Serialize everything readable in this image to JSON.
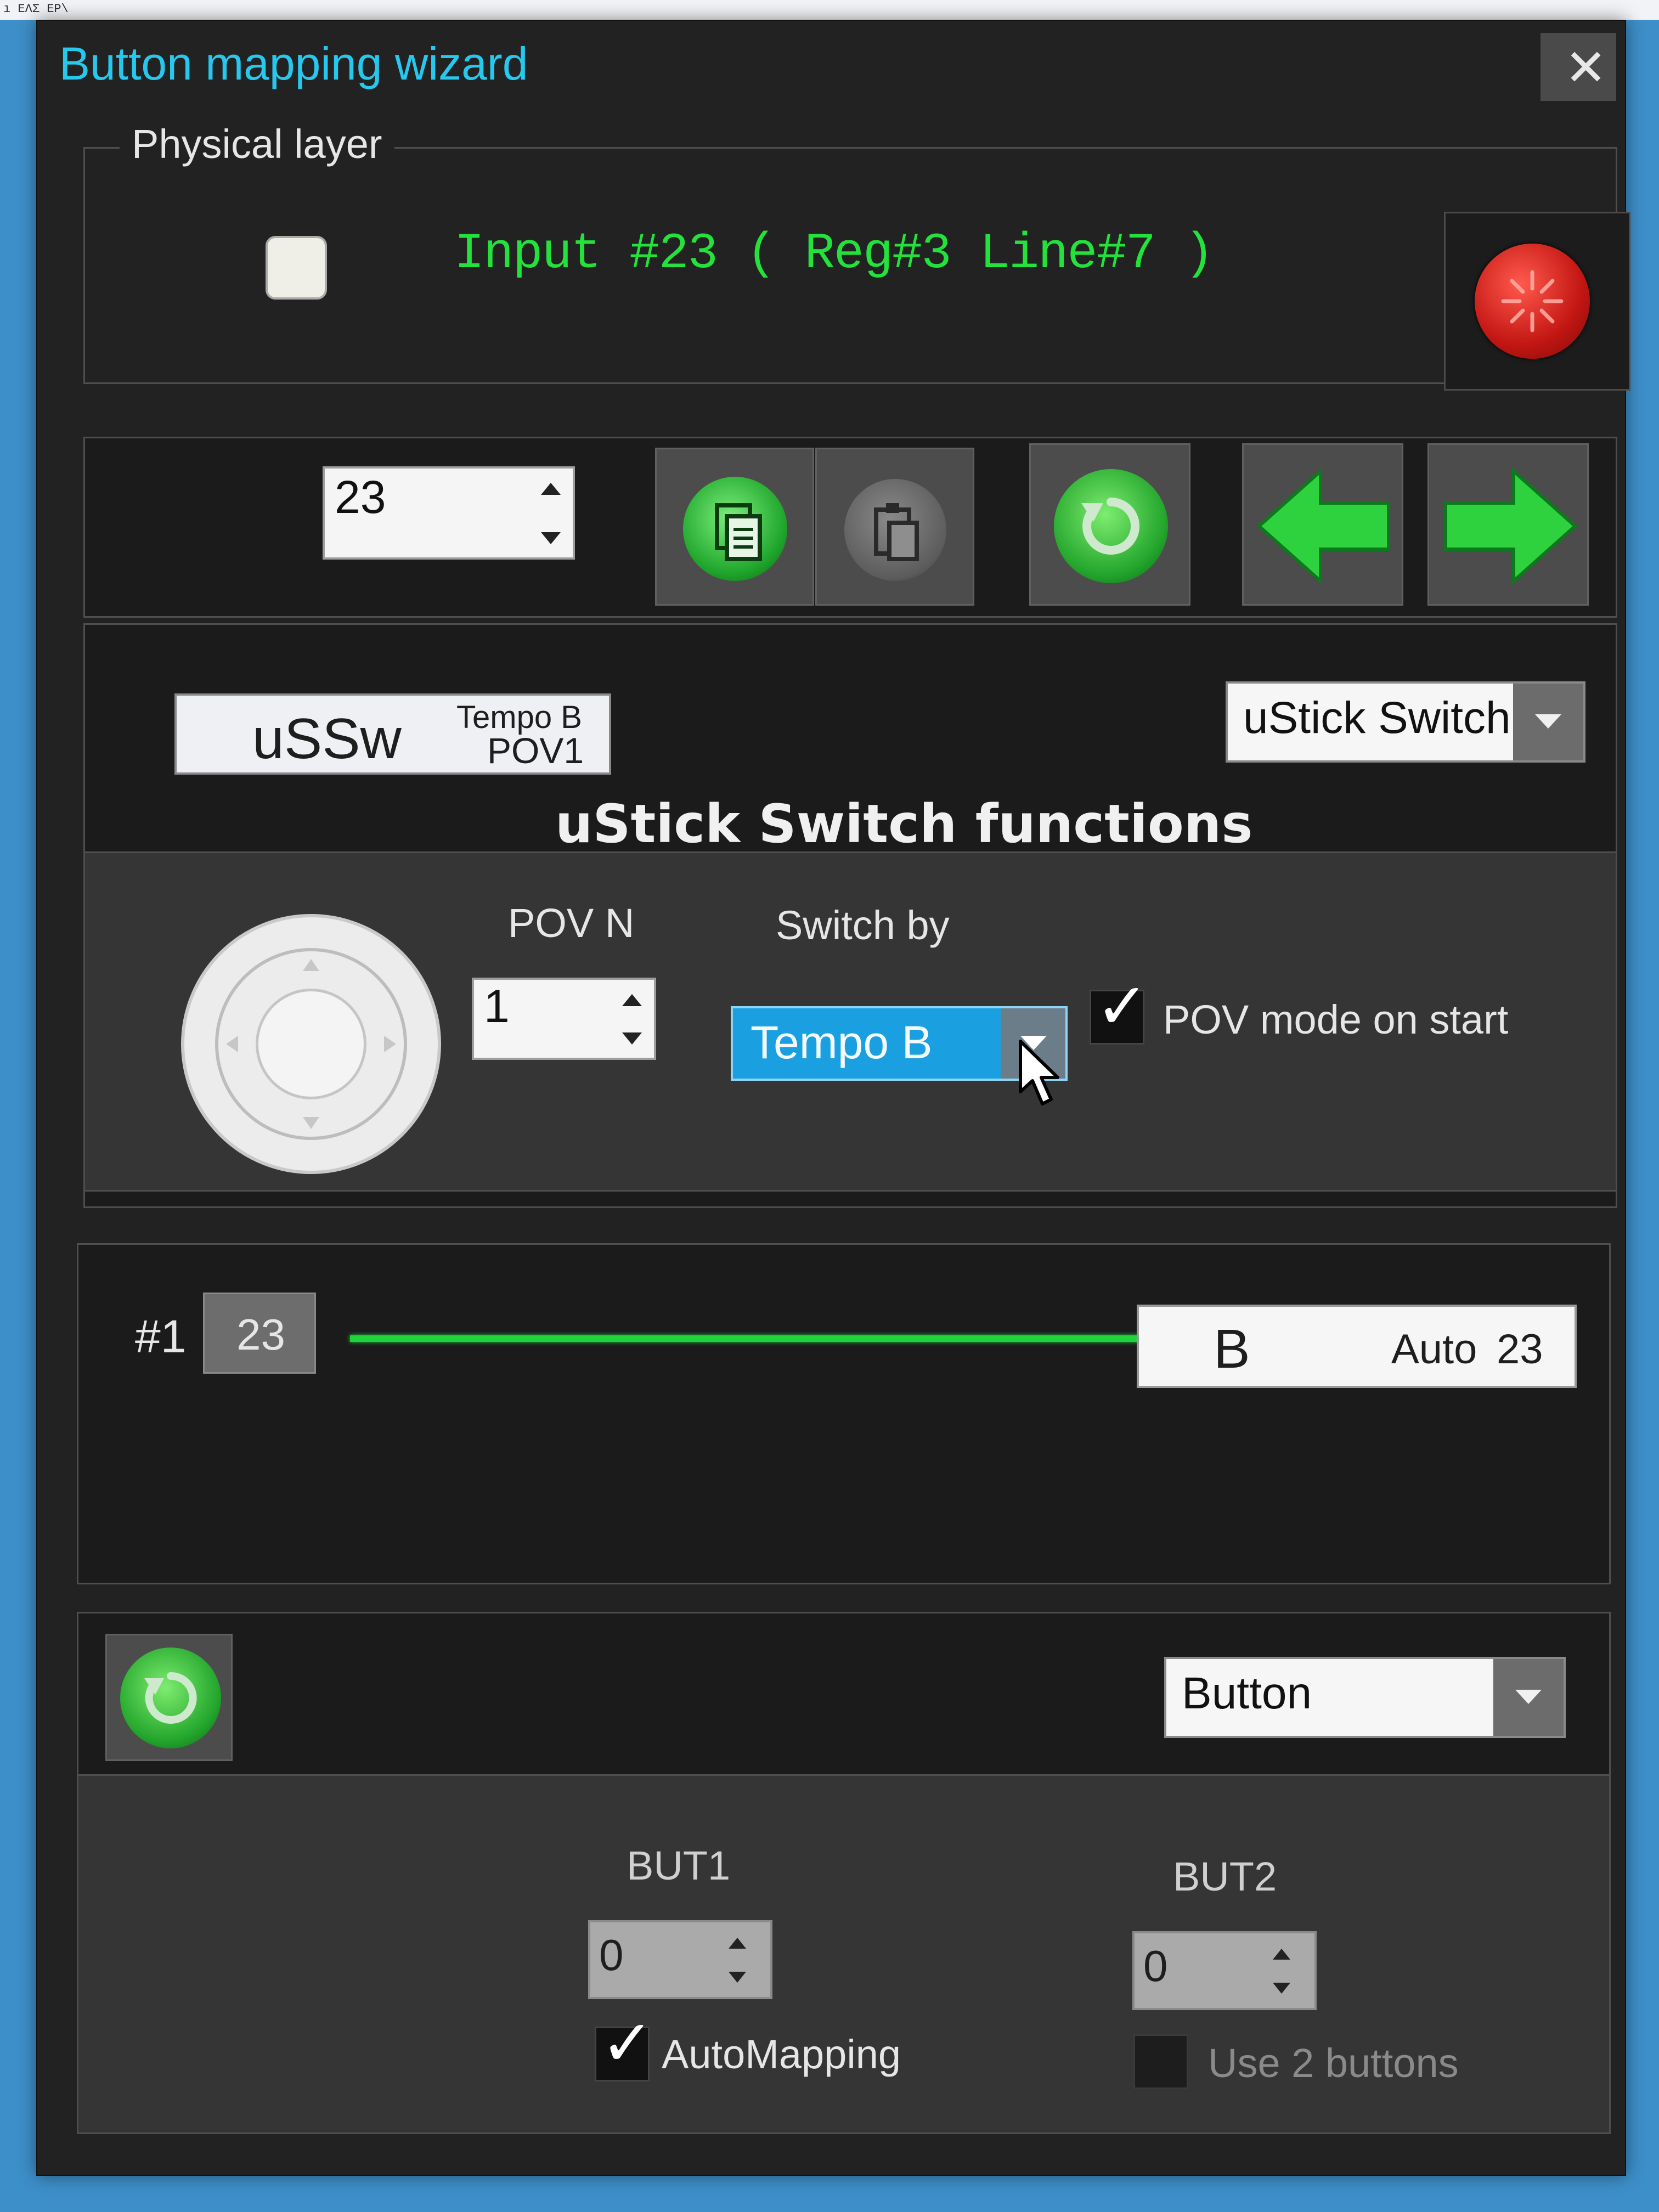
{
  "taskbar": {
    "text": "ı ΕΛΣ ΕΡ\\"
  },
  "window": {
    "title": "Button mapping wizard",
    "close_glyph": "✕"
  },
  "physical_layer": {
    "legend": "Physical layer",
    "input_text": "Input #23  ( Reg#3   Line#7 )",
    "led_color": "#d11b16"
  },
  "toolbar": {
    "number_value": "23",
    "icons": [
      "copy-icon",
      "paste-icon",
      "reset-icon",
      "prev-arrow-icon",
      "next-arrow-icon"
    ],
    "accent": "#27c52f"
  },
  "function": {
    "tag_main": "uSSw",
    "tag_sub1": "Tempo B",
    "tag_sub2": "POV1",
    "type_select": "uStick Switch",
    "section_title": "uStick Switch functions",
    "pov_label": "POV N",
    "pov_value": "1",
    "switch_label": "Switch by",
    "switch_value": "Tempo B",
    "pov_mode_label": "POV mode on start",
    "pov_mode_checked": true
  },
  "mapping": {
    "index_label": "#1",
    "input_number": "23",
    "target_letter": "B",
    "target_mode": "Auto",
    "target_number": "23"
  },
  "output": {
    "type_select": "Button",
    "but1_label": "BUT1",
    "but1_value": "0",
    "but2_label": "BUT2",
    "but2_value": "0",
    "automapping_label": "AutoMapping",
    "automapping_checked": true,
    "use2_label": "Use 2 buttons",
    "use2_checked": false
  },
  "colors": {
    "title": "#27c8ee",
    "status_green": "#23e23c",
    "selection_blue": "#1aa0e0"
  }
}
